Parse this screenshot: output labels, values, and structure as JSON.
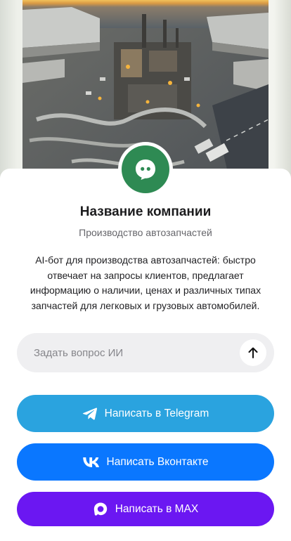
{
  "company": {
    "name": "Название компании",
    "category": "Производство автозапчастей",
    "description": "AI-бот для производства автозапчастей: быстро отвечает на запросы клиентов, предлагает информацию о наличии, ценах и различных типах запчастей для легковых и грузовых автомобилей."
  },
  "ask": {
    "placeholder": "Задать вопрос ИИ",
    "value": ""
  },
  "buttons": {
    "telegram": {
      "label": "Написать в Telegram",
      "color": "#2aa3df",
      "icon": "telegram-icon"
    },
    "vk": {
      "label": "Написать Вконтакте",
      "color": "#0a77ff",
      "icon": "vk-icon"
    },
    "max": {
      "label": "Написать в MAX",
      "color": "#6b17f2",
      "icon": "max-icon"
    }
  },
  "colors": {
    "avatar": "#2e8a53",
    "ask_bg": "#efeff1"
  }
}
